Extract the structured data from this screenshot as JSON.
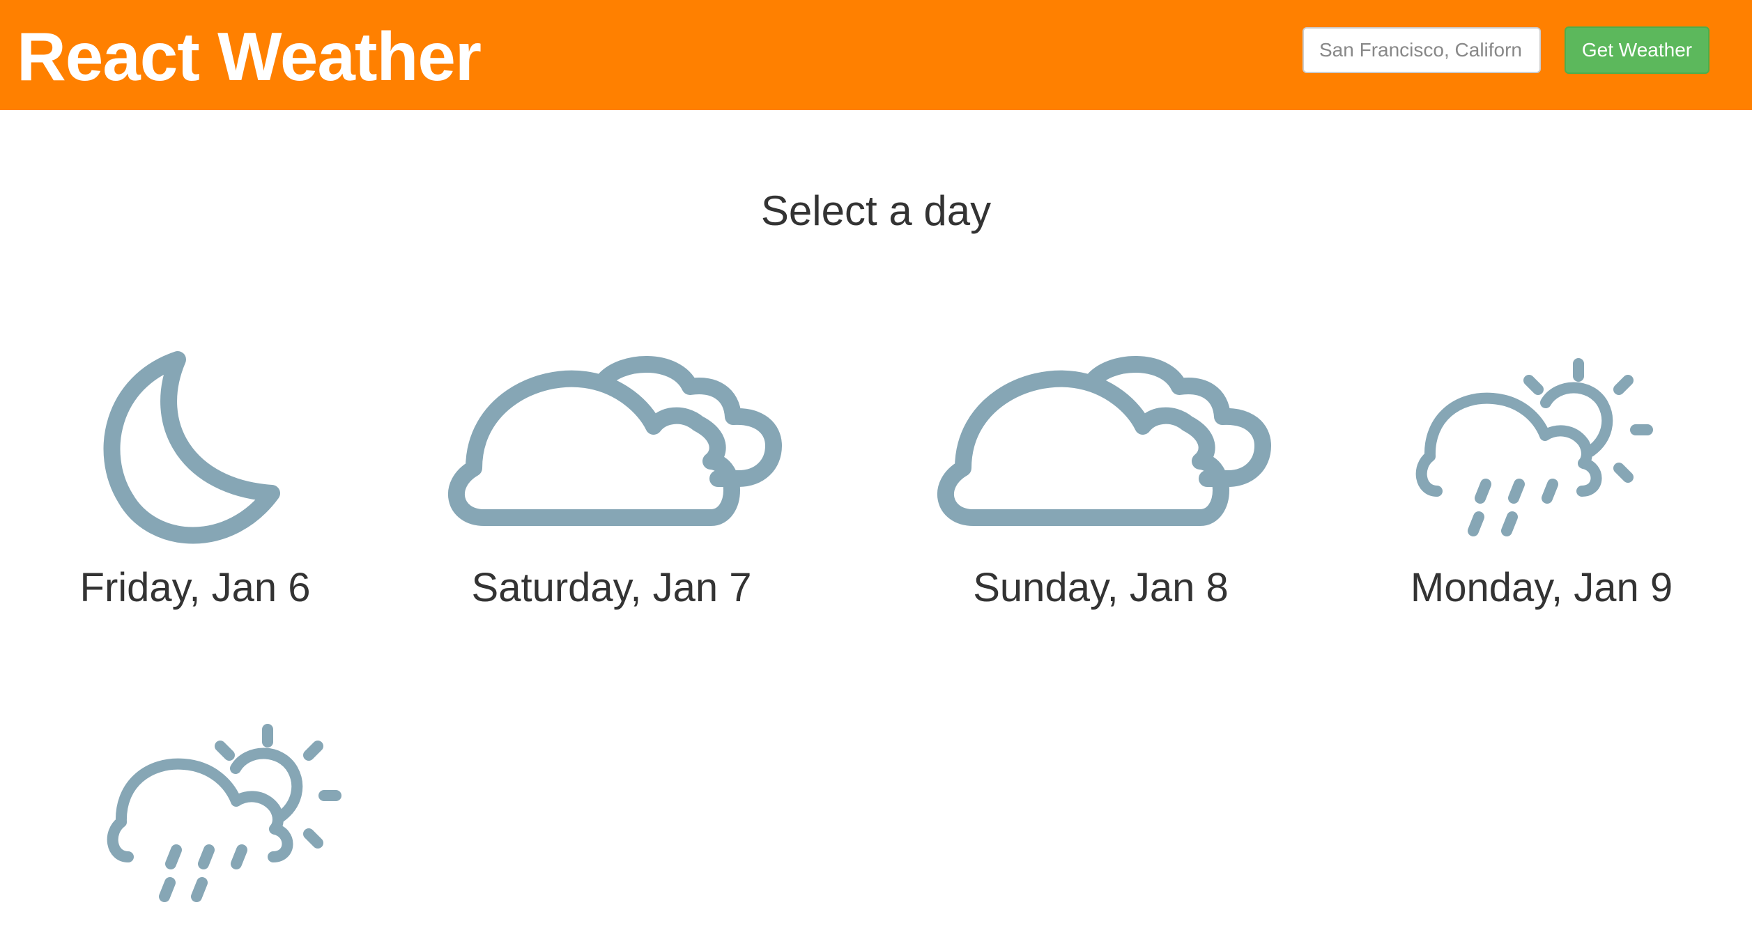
{
  "header": {
    "title": "React Weather",
    "search_placeholder": "San Francisco, Californ",
    "button_label": "Get Weather",
    "bar_color": "#ff8000",
    "button_color": "#5cb85c"
  },
  "main": {
    "heading": "Select a day",
    "days": [
      {
        "label": "Friday, Jan 6",
        "icon": "moon-icon"
      },
      {
        "label": "Saturday, Jan 7",
        "icon": "clouds-icon"
      },
      {
        "label": "Sunday, Jan 8",
        "icon": "clouds-icon"
      },
      {
        "label": "Monday, Jan 9",
        "icon": "rain-sun-icon"
      },
      {
        "label": "",
        "icon": "rain-sun-icon"
      }
    ],
    "icon_color": "#86a6b5"
  }
}
